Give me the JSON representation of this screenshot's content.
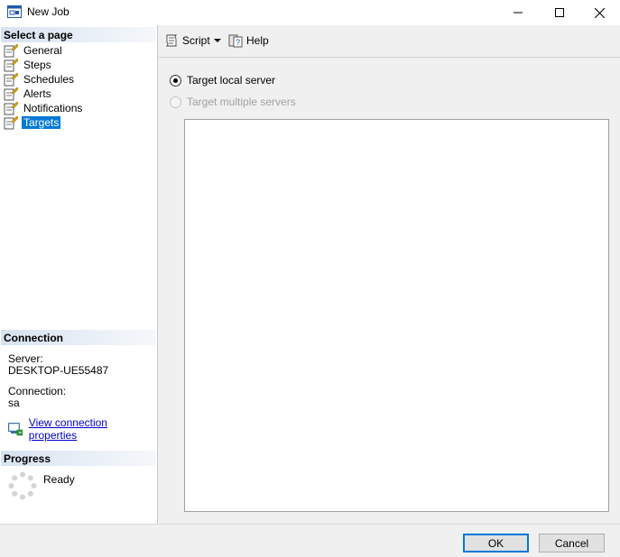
{
  "window": {
    "title": "New Job"
  },
  "left_panel": {
    "select_page_header": "Select a page",
    "pages": [
      {
        "label": "General"
      },
      {
        "label": "Steps"
      },
      {
        "label": "Schedules"
      },
      {
        "label": "Alerts"
      },
      {
        "label": "Notifications"
      },
      {
        "label": "Targets",
        "selected": true
      }
    ],
    "connection_header": "Connection",
    "server_label": "Server:",
    "server_value": "DESKTOP-UE55487",
    "connection_label": "Connection:",
    "connection_value": "sa",
    "view_connection_link": "View connection properties",
    "progress_header": "Progress",
    "progress_status": "Ready"
  },
  "toolbar": {
    "script_label": "Script",
    "help_label": "Help"
  },
  "targets": {
    "option_local": "Target local server",
    "option_multiple": "Target multiple servers",
    "selected": "local"
  },
  "buttons": {
    "ok": "OK",
    "cancel": "Cancel"
  },
  "colors": {
    "selection": "#0078d7",
    "link": "#0000cc",
    "header_gradient_start": "#d7e2f0"
  }
}
